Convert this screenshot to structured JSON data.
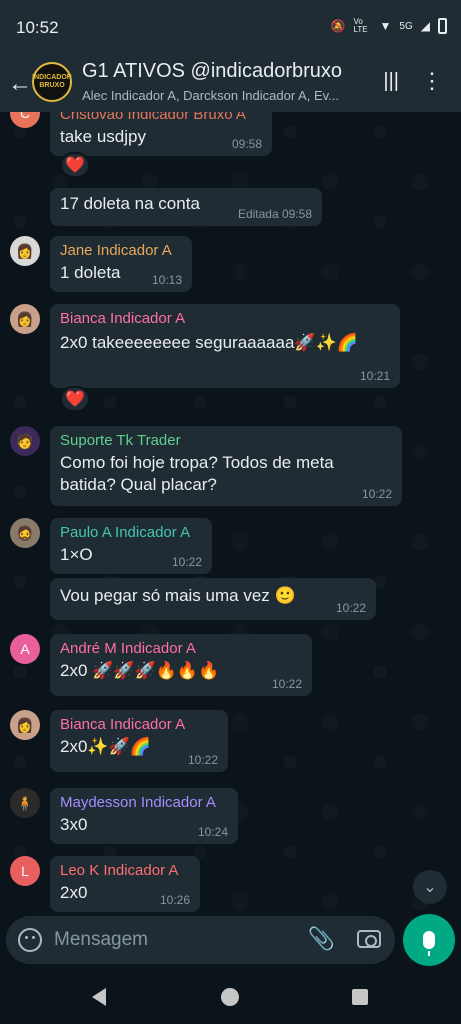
{
  "status": {
    "time": "10:52",
    "icons": [
      "mute-icon",
      "volte-icon",
      "wifi-icon",
      "5g-icon",
      "signal-icon",
      "battery-icon"
    ],
    "volte_label": "Vo LTE",
    "network_label": "5G"
  },
  "header": {
    "title": "G1 ATIVOS @indicadorbruxo",
    "subtitle": "Alec Indicador A, Darckson Indicador A, Ev...",
    "avatar_text": "INDICADOR BRUXO"
  },
  "messages": [
    {
      "sender": "Cristóvão Indicador Bruxo A",
      "sender_color": "#e8735b",
      "text": "take usdjpy",
      "time": "09:58",
      "avatar": "C",
      "avatar_color": "#e8735b"
    },
    {
      "reaction": "❤️"
    },
    {
      "text": "17 doleta na conta",
      "time": "Editada 09:58"
    },
    {
      "sender": "Jane Indicador A",
      "sender_color": "#e6a85a",
      "text": "1 doleta",
      "time": "10:13"
    },
    {
      "sender": "Bianca Indicador A",
      "sender_color": "#ff6fa3",
      "text": "2x0 takeeeeeeee seguraaaaaa🚀✨🌈",
      "time": "10:21"
    },
    {
      "reaction": "❤️"
    },
    {
      "sender": "Suporte Tk Trader",
      "sender_color": "#5fcf8f",
      "text_lines": [
        "Como foi hoje tropa? Todos de meta",
        "batida? Qual placar?"
      ],
      "time": "10:22"
    },
    {
      "sender": "Paulo A Indicador A",
      "sender_color": "#45c4b0",
      "text": "1×O",
      "time": "10:22"
    },
    {
      "text": "Vou pegar só mais uma vez 🙂",
      "time": "10:22"
    },
    {
      "sender": "André M Indicador A",
      "sender_color": "#ff6fa3",
      "text": "2x0 🚀🚀🚀🔥🔥🔥",
      "time": "10:22",
      "avatar": "A",
      "avatar_color": "#e85f9a"
    },
    {
      "sender": "Bianca Indicador A",
      "sender_color": "#ff6fa3",
      "text": "2x0✨🚀🌈",
      "time": "10:22"
    },
    {
      "sender": "Maydesson Indicador A",
      "sender_color": "#a58cff",
      "text": "3x0",
      "time": "10:24"
    },
    {
      "sender": "Leo K Indicador A",
      "sender_color": "#ff6f6f",
      "text": "2x0",
      "time": "10:26",
      "avatar": "L",
      "avatar_color": "#e85f5f"
    }
  ],
  "composer": {
    "placeholder": "Mensagem"
  },
  "colors": {
    "background": "#0b141a",
    "bubble": "#1f2c34",
    "accent": "#00a884"
  }
}
